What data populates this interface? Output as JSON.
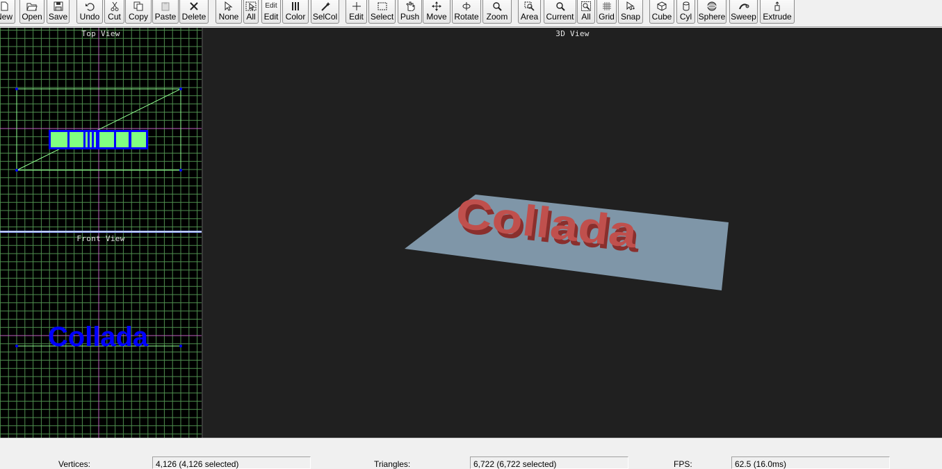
{
  "toolbar": {
    "buttons": [
      {
        "label": "New",
        "icon": "new-file-icon"
      },
      {
        "label": "Open",
        "icon": "open-folder-icon"
      },
      {
        "label": "Save",
        "icon": "save-disk-icon"
      },
      {
        "label": "Undo",
        "icon": "undo-arrow-icon"
      },
      {
        "label": "Cut",
        "icon": "scissors-icon"
      },
      {
        "label": "Copy",
        "icon": "copy-icon"
      },
      {
        "label": "Paste",
        "icon": "paste-icon"
      },
      {
        "label": "Delete",
        "icon": "delete-x-icon"
      },
      {
        "label": "None",
        "icon": "select-none-icon"
      },
      {
        "label": "All",
        "icon": "select-all-icon"
      },
      {
        "label": "Edit",
        "icon": "edit-text-icon",
        "icon_text": "Edit"
      },
      {
        "label": "Color",
        "icon": "color-bars-icon"
      },
      {
        "label": "SelCol",
        "icon": "magic-wand-icon"
      },
      {
        "label": "Edit",
        "icon": "crosshair-plus-icon"
      },
      {
        "label": "Select",
        "icon": "marquee-select-icon"
      },
      {
        "label": "Push",
        "icon": "push-hand-icon"
      },
      {
        "label": "Move",
        "icon": "move-arrows-icon"
      },
      {
        "label": "Rotate",
        "icon": "rotate-icon"
      },
      {
        "label": "Zoom",
        "icon": "magnifier-icon"
      },
      {
        "label": "Area",
        "icon": "zoom-area-icon"
      },
      {
        "label": "Current",
        "icon": "zoom-current-icon"
      },
      {
        "label": "All",
        "icon": "zoom-all-icon"
      },
      {
        "label": "Grid",
        "icon": "grid-icon"
      },
      {
        "label": "Snap",
        "icon": "snap-cursor-icon"
      },
      {
        "label": "Cube",
        "icon": "cube-icon"
      },
      {
        "label": "Cyl",
        "icon": "cylinder-icon"
      },
      {
        "label": "Sphere",
        "icon": "sphere-icon"
      },
      {
        "label": "Sweep",
        "icon": "sweep-icon"
      },
      {
        "label": "Extrude",
        "icon": "extrude-icon"
      }
    ]
  },
  "views": {
    "top_title": "Top View",
    "front_title": "Front View",
    "perspective_title": "3D View",
    "model_text": "Collada"
  },
  "colors": {
    "grid_line": "#4f8f4f",
    "axis_line": "#c060c0",
    "selection_blue": "#0000ff",
    "selected_face": "#80ff80",
    "ground_plane": "#7f96a8",
    "model_red": "#c0504d",
    "view3d_bg": "#202020"
  },
  "status": {
    "vertices_label": "Vertices:",
    "vertices_value": "4,126   (4,126 selected)",
    "triangles_label": "Triangles:",
    "triangles_value": "6,722   (6,722 selected)",
    "fps_label": "FPS:",
    "fps_value": "62.5 (16.0ms)"
  }
}
